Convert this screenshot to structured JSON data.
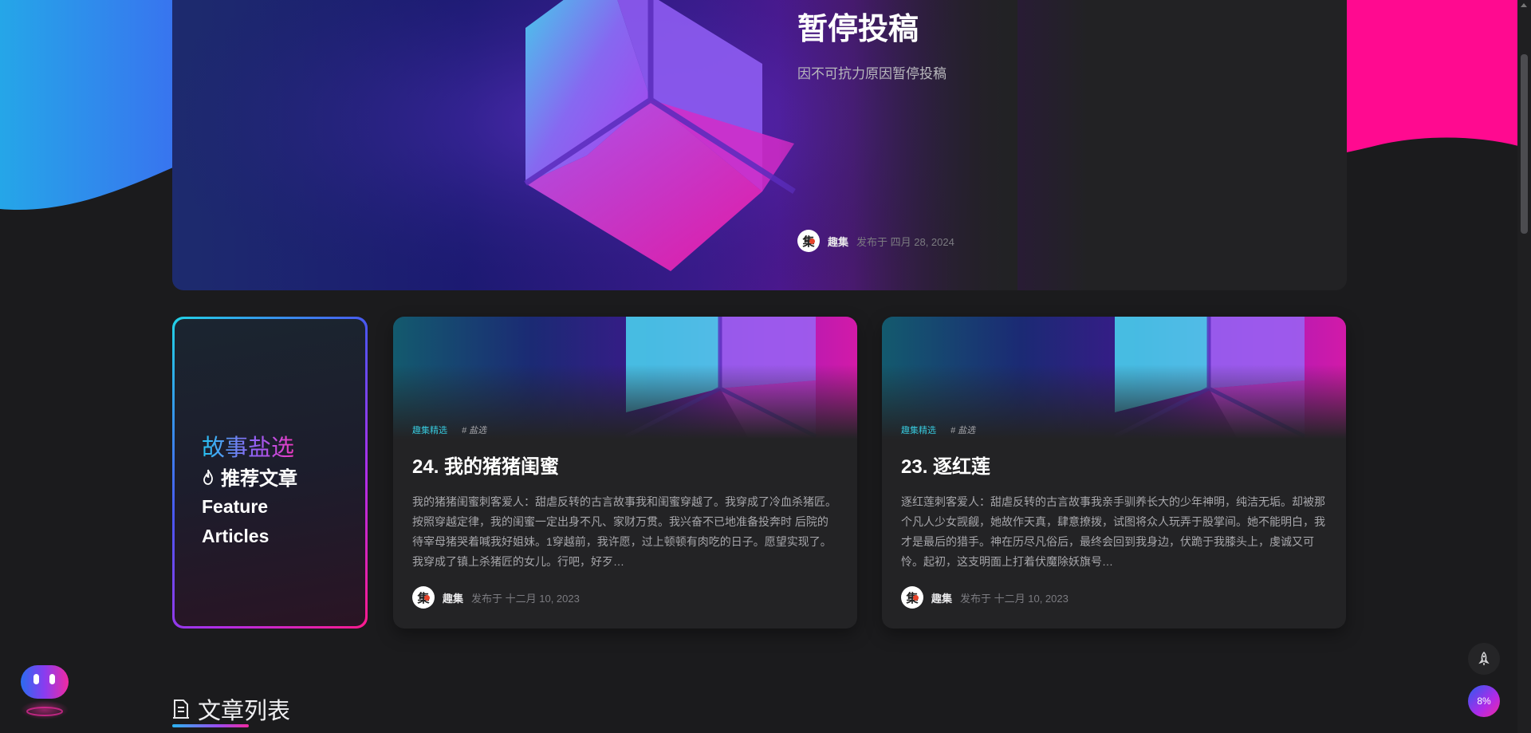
{
  "hero": {
    "title": "暂停投稿",
    "subtitle": "因不可抗力原因暂停投稿",
    "author": "趣集",
    "date": "发布于 四月 28, 2024"
  },
  "feature": {
    "kicker": "故事盐选",
    "hot_label": "推荐文章",
    "english_label": "Feature Articles"
  },
  "cards": [
    {
      "category": "趣集精选",
      "tag": "# 盐选",
      "title": "24. 我的猪猪闺蜜",
      "excerpt": "我的猪猪闺蜜刺客爱人：甜虐反转的古言故事我和闺蜜穿越了。我穿成了冷血杀猪匠。按照穿越定律，我的闺蜜一定出身不凡、家财万贯。我兴奋不已地准备投奔时 后院的待宰母猪哭着喊我好姐妹。1穿越前，我许愿，过上顿顿有肉吃的日子。愿望实现了。我穿成了镇上杀猪匠的女儿。行吧，好歹…",
      "author": "趣集",
      "date": "发布于 十二月 10, 2023"
    },
    {
      "category": "趣集精选",
      "tag": "# 盐选",
      "title": "23. 逐红莲",
      "excerpt": "逐红莲刺客爱人：甜虐反转的古言故事我亲手驯养长大的少年神明，纯洁无垢。却被那个凡人少女觊觎，她故作天真，肆意撩拨，试图将众人玩弄于股掌间。她不能明白，我才是最后的猎手。神在历尽凡俗后，最终会回到我身边，伏跪于我膝头上，虔诚又可怜。起初，这支明面上打着伏魔除妖旗号…",
      "author": "趣集",
      "date": "发布于 十二月 10, 2023"
    }
  ],
  "article_list": {
    "title": "文章列表"
  },
  "widgets": {
    "read_progress": "8%"
  },
  "colors": {
    "accent_cyan": "#37c6d9",
    "accent_pink": "#ff1a8c",
    "accent_purple": "#9a4cf0"
  }
}
